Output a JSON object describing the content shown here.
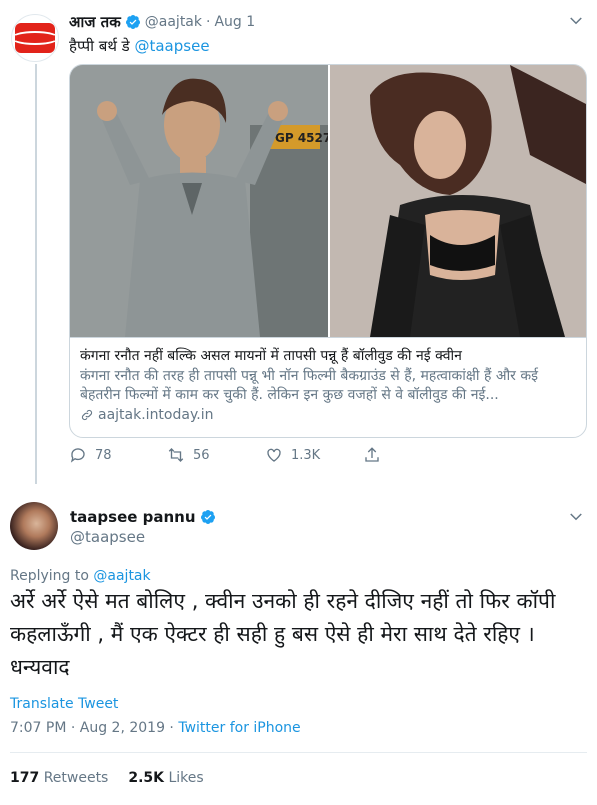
{
  "parent_tweet": {
    "name": "आज तक",
    "handle": "@aajtak",
    "date": "Aug 1",
    "text_prefix": "हैप्पी बर्थ डे ",
    "text_mention": "@taapsee",
    "avatar_logo_text": "आजतक",
    "card": {
      "title": "कंगना रनौत नहीं बल्कि असल मायनों में तापसी पन्नू हैं बॉलीवुड की नई क्वीन",
      "description": "कंगना रनौत की तरह ही तापसी पन्नू भी नॉन फिल्मी बैकग्राउंड से हैं, महत्वाकांक्षी हैं और कई बेहतरीन फिल्मों में काम कर चुकी हैं. लेकिन इन कुछ वजहों से वे बॉलीवुड की नई...",
      "domain": "aajtak.intoday.in",
      "plate_text": "GP 4527"
    },
    "actions": {
      "replies": "78",
      "retweets": "56",
      "likes": "1.3K"
    }
  },
  "main_tweet": {
    "name": "taapsee pannu",
    "handle": "@taapsee",
    "replying_label": "Replying to ",
    "replying_mention": "@aajtak",
    "text": "अर्रे अर्रे ऐसे मत बोलिए , क्वीन उनको ही रहने दीजिए नहीं तो फिर कॉपी कहलाऊँगी  , मैं एक ऐक्टर ही सही हु बस ऐसे ही मेरा साथ देते रहिए । धन्यवाद",
    "translate": "Translate Tweet",
    "time_date": "7:07 PM · Aug 2, 2019 · ",
    "source": "Twitter for iPhone",
    "retweets_count": "177",
    "retweets_label": "Retweets",
    "likes_count": "2.5K",
    "likes_label": "Likes"
  },
  "colors": {
    "link": "#1b95e0",
    "secondary_text": "#657786",
    "brand_red": "#e2231a",
    "verified": "#1da1f2"
  }
}
